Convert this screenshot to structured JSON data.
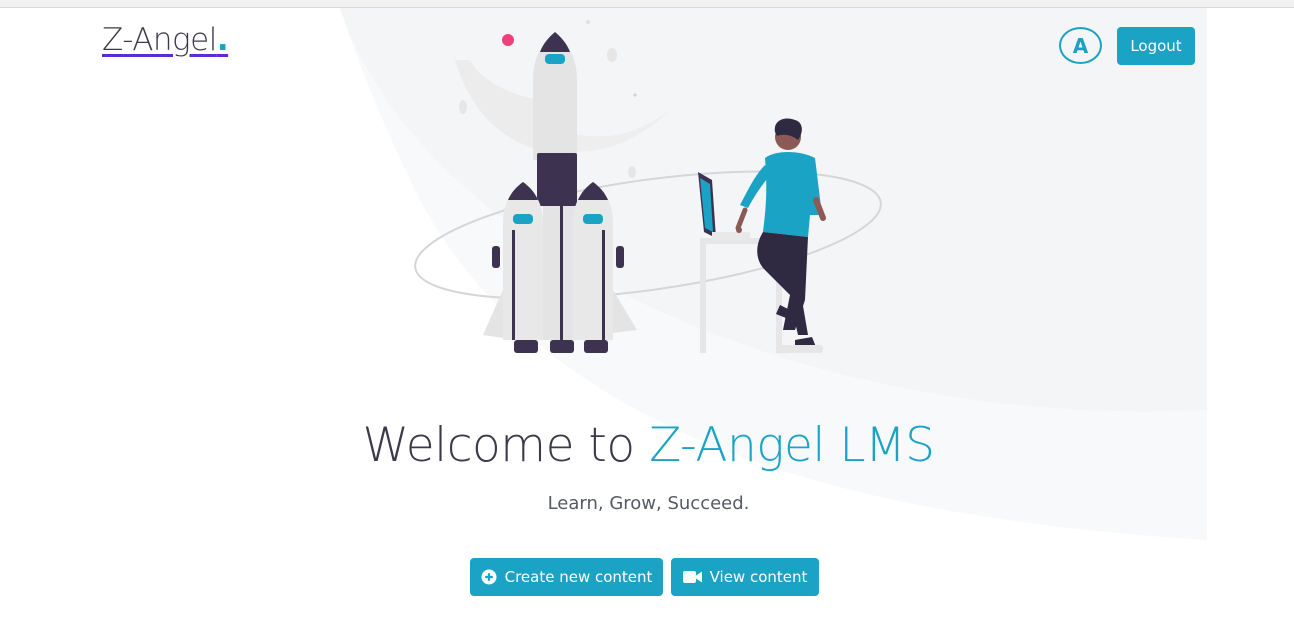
{
  "header": {
    "brand_text": "Z-Angel",
    "brand_dot": ".",
    "avatar_initial": "A",
    "logout_label": "Logout"
  },
  "hero": {
    "welcome_prefix": "Welcome to ",
    "welcome_accent": "Z-Angel LMS",
    "subtitle": "Learn, Grow, Succeed."
  },
  "actions": {
    "create_label": "Create new content",
    "create_icon": "plus-circle-icon",
    "view_label": "View content",
    "view_icon": "video-camera-icon"
  },
  "colors": {
    "accent": "#1ba3c6",
    "dark": "#3b3a4a",
    "brand_underline": "#5b2bd6"
  }
}
